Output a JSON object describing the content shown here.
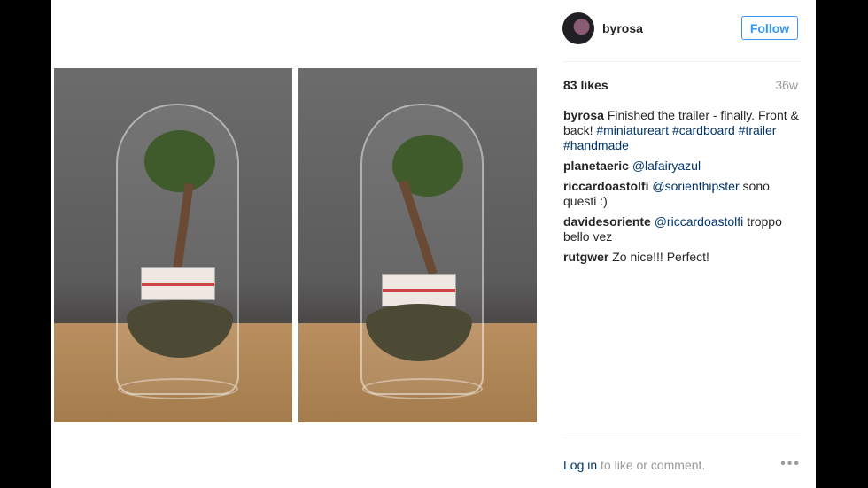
{
  "post": {
    "username": "byrosa",
    "follow_label": "Follow",
    "likes": "83 likes",
    "age": "36w",
    "caption": {
      "user": "byrosa",
      "text": "Finished the trailer - finally. Front & back!",
      "tags": "#miniatureart #cardboard #trailer #handmade"
    },
    "comments": [
      {
        "user": "planetaeric",
        "mention": "@lafairyazul",
        "text": ""
      },
      {
        "user": "riccardoastolfi",
        "mention": "@sorienthipster",
        "text": "sono questi :)"
      },
      {
        "user": "davidesoriente",
        "mention": "@riccardoastolfi",
        "text": "troppo bello vez"
      },
      {
        "user": "rutgwer",
        "mention": "",
        "text": "Zo nice!!! Perfect!"
      }
    ],
    "footer": {
      "login": "Log in",
      "prompt": "to like or comment.",
      "more": "•••"
    }
  },
  "icons": [
    "avatar",
    "more-options-icon"
  ]
}
